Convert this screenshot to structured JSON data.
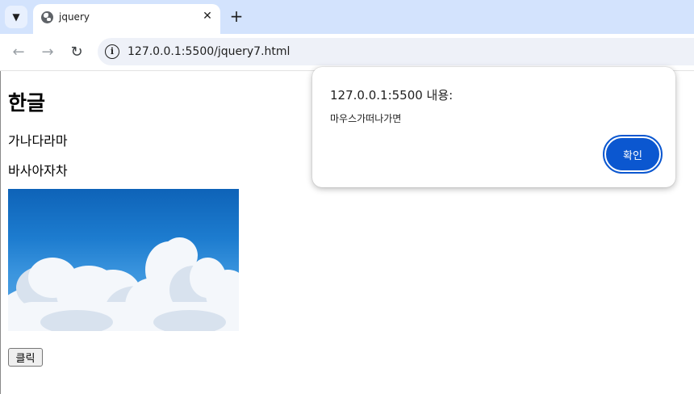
{
  "browser": {
    "tab_title": "jquery",
    "tab_menu_icon": "chevron-down-icon",
    "close_glyph": "✕",
    "new_tab_glyph": "+",
    "url": "127.0.0.1:5500/jquery7.html",
    "accent": "#d3e3fd"
  },
  "page": {
    "heading": "한글",
    "paragraphs": [
      "가나다라마",
      "바사아자차"
    ],
    "image_icon": "sky-clouds-image",
    "button_label": "클릭"
  },
  "dialog": {
    "title": "127.0.0.1:5500 내용:",
    "message": "마우스가떠나가면",
    "ok_label": "확인",
    "accent": "#0b57d0"
  }
}
